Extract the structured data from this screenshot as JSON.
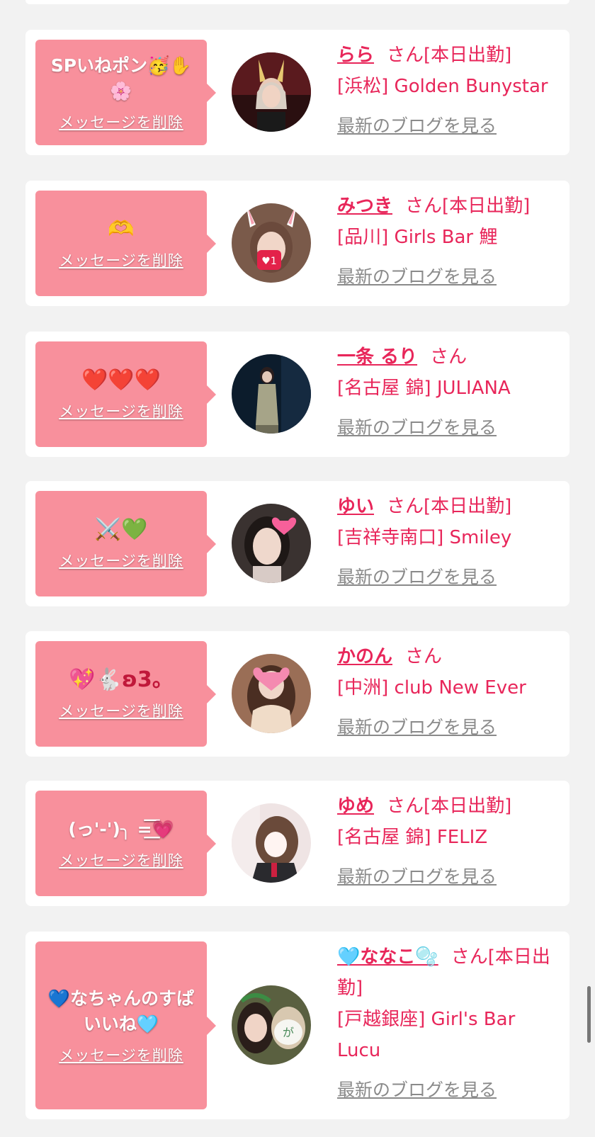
{
  "accent": "#e8265a",
  "bubble_color": "#f8909c",
  "delete_label": "メッセージを削除",
  "san_label": "さん",
  "blog_label": "最新のブログを見る",
  "cards": [
    {
      "message": "SPいねポン🥳✋🌸",
      "name": "らら",
      "status": "[本日出勤]",
      "shop": "[浜松] Golden Bunystar"
    },
    {
      "message": "🫶",
      "name": "みつき",
      "status": "[本日出勤]",
      "shop": "[品川] Girls Bar 鯉"
    },
    {
      "message": "❤️❤️❤️",
      "name": "一条 るり",
      "status": "",
      "shop": "[名古屋 錦] JULIANA"
    },
    {
      "message": "⚔️💚",
      "name": "ゆい",
      "status": "[本日出勤]",
      "shop": "[吉祥寺南口] Smiley"
    },
    {
      "message": "💖🐇ʚ3。",
      "name": "かのん",
      "status": "",
      "shop": "[中洲] club New Ever"
    },
    {
      "message": "(っ'-')╮ =͟͟͞͞💗",
      "name": "ゆめ",
      "status": "[本日出勤]",
      "shop": "[名古屋 錦] FELIZ"
    },
    {
      "message": "💙なちゃんのすぱいいね🩵",
      "name": "🩵ななこ🫧",
      "status": "[本日出勤]",
      "shop": "[戸越銀座] Girl's Bar Lucu"
    }
  ]
}
